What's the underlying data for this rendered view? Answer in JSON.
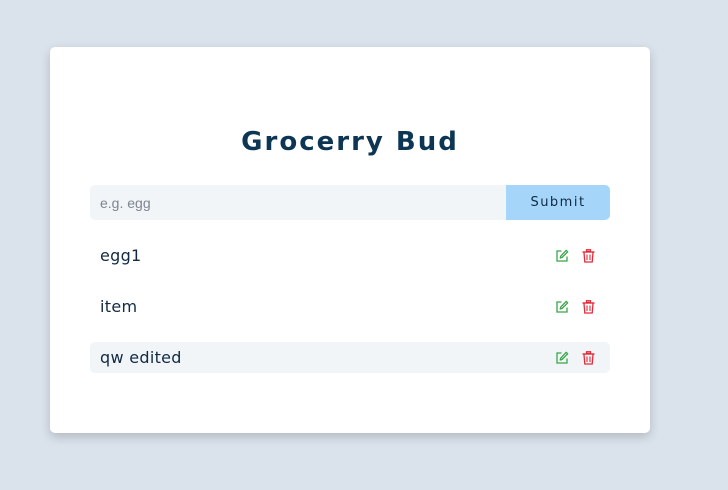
{
  "app": {
    "title": "Grocerry Bud"
  },
  "form": {
    "input_value": "",
    "input_placeholder": "e.g. egg",
    "submit_label": "Submit"
  },
  "items": [
    {
      "name": "egg1",
      "highlighted": false
    },
    {
      "name": "item",
      "highlighted": false
    },
    {
      "name": "qw edited",
      "highlighted": true
    }
  ],
  "icons": {
    "edit": "edit-icon",
    "delete": "trash-icon"
  },
  "colors": {
    "page_bg": "#dae2ec",
    "title": "#0c3653",
    "submit_bg": "#a5d5f8",
    "input_bg": "#f1f5f8",
    "edit_icon": "#3aa54a",
    "delete_icon": "#e02b3a"
  }
}
